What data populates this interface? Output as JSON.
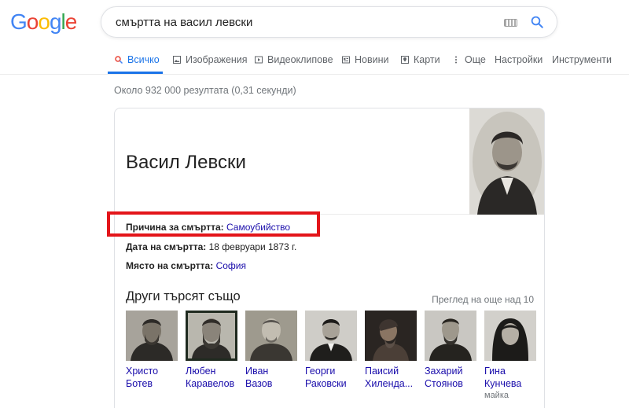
{
  "logo": {
    "letters": [
      "G",
      "o",
      "o",
      "g",
      "l",
      "e"
    ],
    "colors": [
      "#4285F4",
      "#EA4335",
      "#FBBC05",
      "#4285F4",
      "#34A853",
      "#EA4335"
    ]
  },
  "search": {
    "query": "смъртта на васил левски",
    "icons": [
      "keyboard-icon",
      "search-icon"
    ]
  },
  "tabs": [
    {
      "label": "Всичко",
      "icon": "search-icon"
    },
    {
      "label": "Изображения",
      "icon": "image-icon"
    },
    {
      "label": "Видеоклипове",
      "icon": "video-icon"
    },
    {
      "label": "Новини",
      "icon": "news-icon"
    },
    {
      "label": "Карти",
      "icon": "map-icon"
    },
    {
      "label": "Още",
      "icon": "more-vert-icon"
    },
    {
      "label": "Настройки"
    },
    {
      "label": "Инструменти"
    }
  ],
  "result_stats": "Около 932 000 резултата (0,31 секунди)",
  "knowledge_panel": {
    "title": "Васил Левски",
    "facts": [
      {
        "label": "Причина за смъртта:",
        "value": "Самоубийство",
        "is_link": true
      },
      {
        "label": "Дата на смъртта:",
        "value": "18 февруари 1873 г.",
        "is_link": false
      },
      {
        "label": "Място на смъртта:",
        "value": "София",
        "is_link": true
      }
    ],
    "also_search": {
      "title": "Други търсят също",
      "more": "Преглед на още над 10",
      "people": [
        {
          "line1": "Христо",
          "line2": "Ботев",
          "sub": ""
        },
        {
          "line1": "Любен",
          "line2": "Каравелов",
          "sub": ""
        },
        {
          "line1": "Иван Вазов",
          "line2": "",
          "sub": ""
        },
        {
          "line1": "Георги",
          "line2": "Раковски",
          "sub": ""
        },
        {
          "line1": "Паисий",
          "line2": "Хилендa...",
          "sub": ""
        },
        {
          "line1": "Захарий",
          "line2": "Стоянов",
          "sub": ""
        },
        {
          "line1": "Гина",
          "line2": "Кунчева",
          "sub": "майка"
        }
      ]
    }
  },
  "colors": {
    "accent": "#1a73e8",
    "link": "#1a0dab",
    "highlight": "#e3151a"
  }
}
